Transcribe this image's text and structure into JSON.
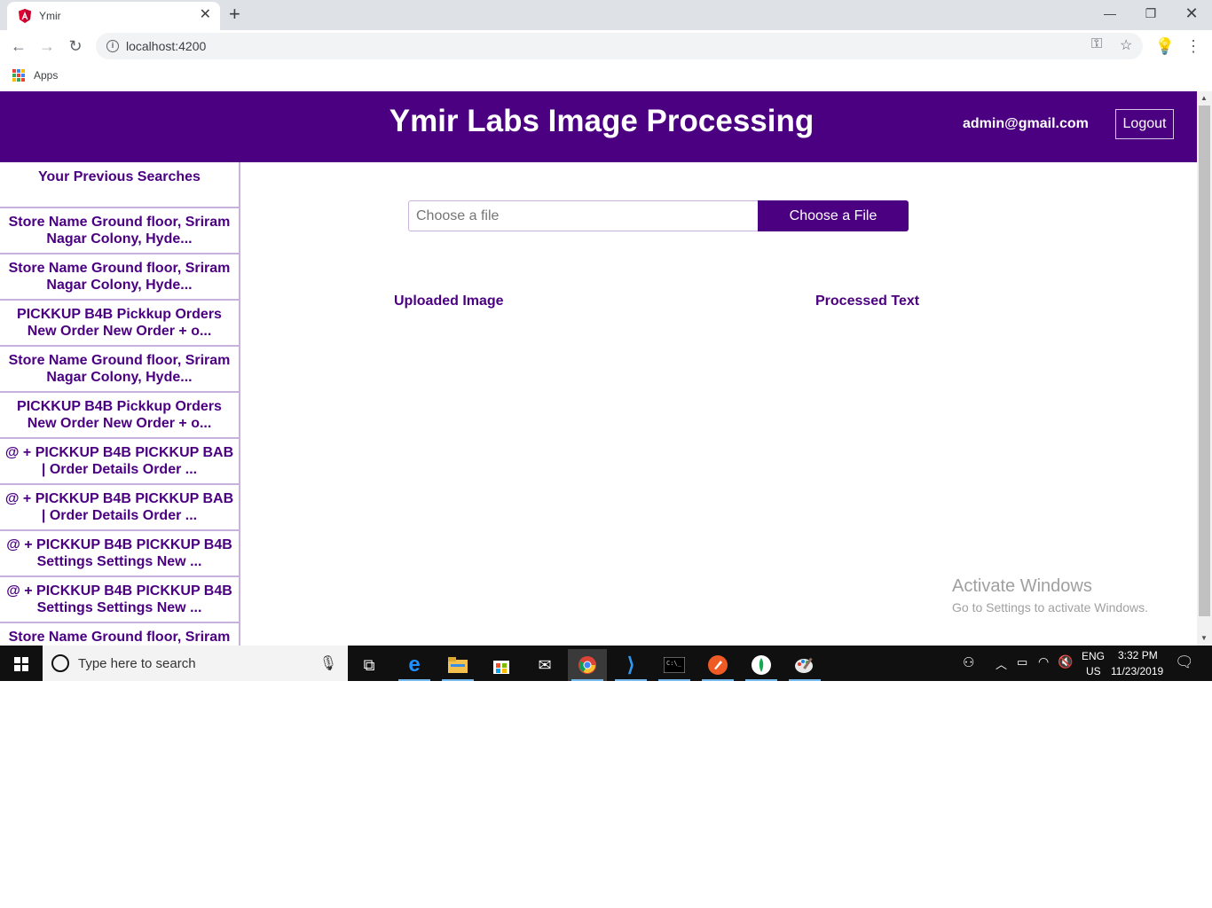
{
  "browser": {
    "tab_title": "Ymir",
    "url": "localhost:4200",
    "bookmarks_apps_label": "Apps"
  },
  "app": {
    "title": "Ymir Labs Image Processing",
    "user_email": "admin@gmail.com",
    "logout_label": "Logout",
    "header_color": "#4b0082"
  },
  "sidebar": {
    "heading": "Your Previous Searches",
    "items": [
      {
        "label": "Store Name Ground floor, Sriram Nagar Colony, Hyde..."
      },
      {
        "label": "Store Name Ground floor, Sriram Nagar Colony, Hyde..."
      },
      {
        "label": "PICKKUP B4B Pickkup Orders New Order New Order + o..."
      },
      {
        "label": "Store Name Ground floor, Sriram Nagar Colony, Hyde..."
      },
      {
        "label": "PICKKUP B4B Pickkup Orders New Order New Order + o..."
      },
      {
        "label": "@ + PICKKUP B4B PICKKUP BAB | Order Details Order ..."
      },
      {
        "label": "@ + PICKKUP B4B PICKKUP BAB | Order Details Order ..."
      },
      {
        "label": "@ + PICKKUP B4B PICKKUP B4B Settings Settings New ..."
      },
      {
        "label": "@ + PICKKUP B4B PICKKUP B4B Settings Settings New ..."
      },
      {
        "label": "Store Name Ground floor, Sriram"
      }
    ]
  },
  "main": {
    "file_placeholder": "Choose a file",
    "file_button_label": "Choose a File",
    "uploaded_image_label": "Uploaded Image",
    "processed_text_label": "Processed Text"
  },
  "watermark": {
    "title": "Activate Windows",
    "subtitle": "Go to Settings to activate Windows."
  },
  "taskbar": {
    "search_placeholder": "Type here to search",
    "language": "ENG",
    "region": "US",
    "time": "3:32 PM",
    "date": "11/23/2019"
  }
}
